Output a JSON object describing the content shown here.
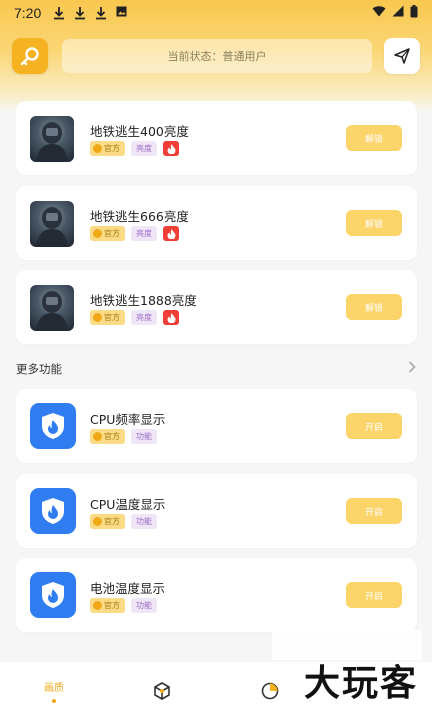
{
  "status_bar": {
    "time": "7:20"
  },
  "header": {
    "status_text": "当前状态：普通用户"
  },
  "game_cards": [
    {
      "title": "地铁逃生400亮度",
      "tag_official": "官方",
      "tag_type": "亮度",
      "action": "解锁"
    },
    {
      "title": "地铁逃生666亮度",
      "tag_official": "官方",
      "tag_type": "亮度",
      "action": "解锁"
    },
    {
      "title": "地铁逃生1888亮度",
      "tag_official": "官方",
      "tag_type": "亮度",
      "action": "解锁"
    }
  ],
  "more_section": {
    "title": "更多功能",
    "more_icon": "chevron-right-icon"
  },
  "feature_cards": [
    {
      "title": "CPU频率显示",
      "tag_official": "官方",
      "tag_type": "功能",
      "action": "开启"
    },
    {
      "title": "CPU温度显示",
      "tag_official": "官方",
      "tag_type": "功能",
      "action": "开启"
    },
    {
      "title": "电池温度显示",
      "tag_official": "官方",
      "tag_type": "功能",
      "action": "开启"
    }
  ],
  "bottom_nav": {
    "items": [
      {
        "label": "画质"
      }
    ]
  },
  "watermark": "大玩客",
  "colors": {
    "accent": "#f5b321",
    "button": "#fbd46a",
    "feature_icon": "#2f7df1",
    "hot_tag": "#ef3e36"
  }
}
